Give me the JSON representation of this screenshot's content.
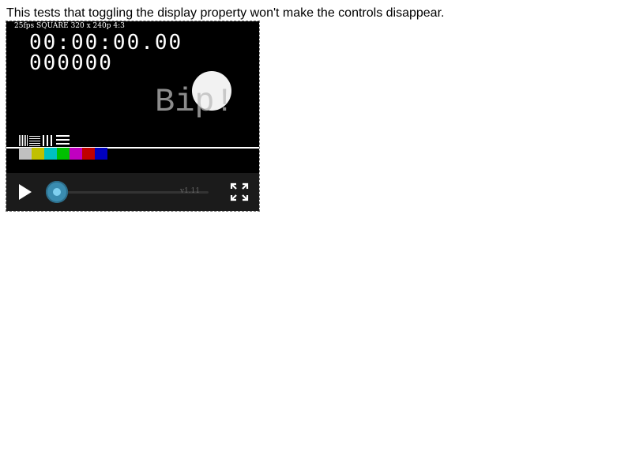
{
  "page": {
    "description": "This tests that toggling the display property won't make the controls disappear."
  },
  "video": {
    "format_label": "25fps SQUARE 320 x 240p 4:3",
    "timecode": "00:00:00.00",
    "frame_counter": "000000",
    "overlay_text": "Bip!",
    "color_bars": [
      "#c0c0c0",
      "#c0c000",
      "#00c0c0",
      "#00c000",
      "#c000c0",
      "#c00000",
      "#0000c0"
    ]
  },
  "controls": {
    "play_icon": "play-icon",
    "fullscreen_icon": "fullscreen-icon",
    "version_label": "v1.11",
    "progress_fraction": 0,
    "accent_color": "#3a8cb0"
  }
}
